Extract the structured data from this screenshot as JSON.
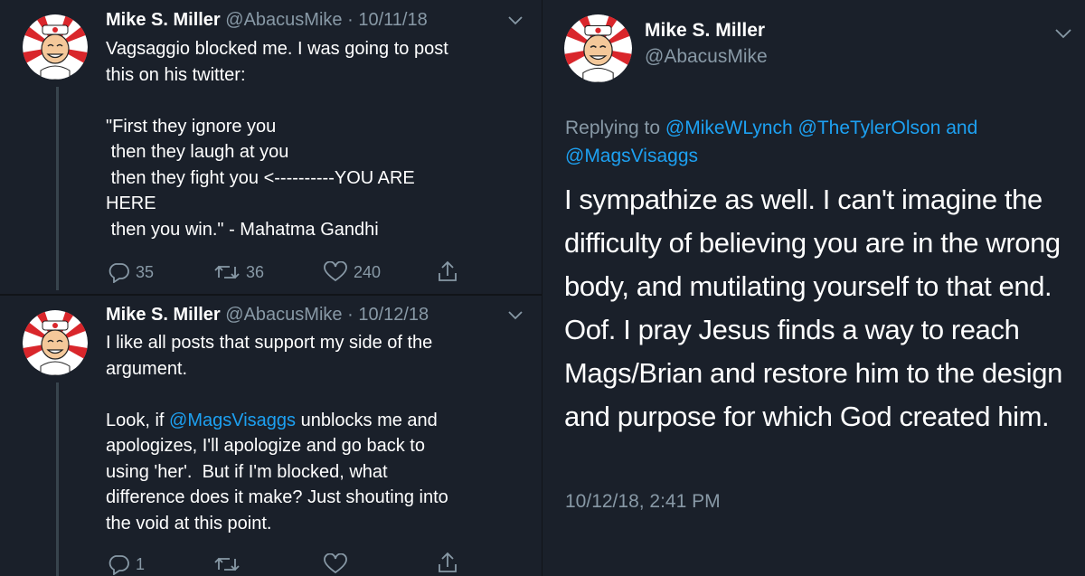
{
  "tweet1": {
    "name": "Mike S. Miller",
    "handle": "@AbacusMike",
    "dot": "·",
    "date": "10/11/18",
    "text": "Vagsaggio blocked me. I was going to post\nthis on his twitter:\n\n\"First they ignore you\n then they laugh at you\n then they fight you <----------YOU ARE\nHERE\n then you win.\" - Mahatma Gandhi",
    "replies": "35",
    "retweets": "36",
    "likes": "240"
  },
  "tweet2": {
    "name": "Mike S. Miller",
    "handle": "@AbacusMike",
    "dot": "·",
    "date": "10/12/18",
    "text_a": "I like all posts that support my side of the\nargument.\n\nLook, if ",
    "mention": "@MagsVisaggs",
    "text_b": " unblocks me and\napologizes, I'll apologize and go back to\nusing 'her'.  But if I'm blocked, what\ndifference does it make? Just shouting into\nthe void at this point.",
    "replies": "1",
    "retweets": "",
    "likes": ""
  },
  "detail": {
    "name": "Mike S. Miller",
    "handle": "@AbacusMike",
    "replying_prefix": "Replying to ",
    "mention1": "@MikeWLynch",
    "mention2": "@TheTylerOlson",
    "and": " and",
    "mention3": "@MagsVisaggs",
    "text": "I sympathize as well.  I can't imagine the difficulty of believing you are in the wrong body, and mutilating yourself to that end.  Oof. I pray Jesus finds a way to reach Mags/Brian and restore him to the design and purpose for which God created him.",
    "timestamp": "10/12/18, 2:41 PM"
  },
  "colors": {
    "background": "#1a202a",
    "text": "#ffffff",
    "secondary": "#8899a6",
    "link": "#1da1f2"
  },
  "icons": [
    "reply-icon",
    "retweet-icon",
    "like-icon",
    "share-icon",
    "chevron-down-icon",
    "avatar"
  ]
}
